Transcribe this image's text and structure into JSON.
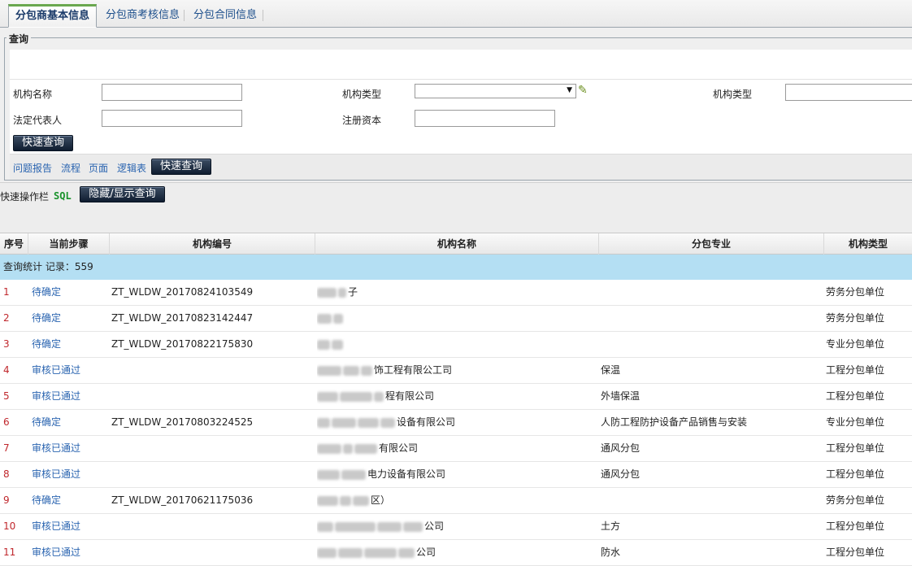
{
  "tabs": [
    {
      "label": "分包商基本信息",
      "active": true
    },
    {
      "label": "分包商考核信息",
      "active": false
    },
    {
      "label": "分包合同信息",
      "active": false
    }
  ],
  "query": {
    "legend": "查询",
    "fields": {
      "org_name_label": "机构名称",
      "org_type_label": "机构类型",
      "org_type2_label": "机构类型",
      "legal_rep_label": "法定代表人",
      "capital_label": "注册资本"
    },
    "quick_search_label": "快速查询",
    "links": [
      "问题报告",
      "流程",
      "页面",
      "逻辑表"
    ],
    "quick_search_label2": "快速查询"
  },
  "quickbar": {
    "label": "快速操作栏",
    "sql": "SQL",
    "toggle_label": "隐藏/显示查询"
  },
  "table": {
    "headers": [
      "序号",
      "当前步骤",
      "机构编号",
      "机构名称",
      "分包专业",
      "机构类型"
    ],
    "stat": "查询统计  记录：559",
    "rows": [
      {
        "idx": "1",
        "step": "待确定",
        "code": "ZT_WLDW_20170824103549",
        "name": "子",
        "spec": "",
        "type": "劳务分包单位"
      },
      {
        "idx": "2",
        "step": "待确定",
        "code": "ZT_WLDW_20170823142447",
        "name": "",
        "spec": "",
        "type": "劳务分包单位"
      },
      {
        "idx": "3",
        "step": "待确定",
        "code": "ZT_WLDW_20170822175830",
        "name": "",
        "spec": "",
        "type": "专业分包单位"
      },
      {
        "idx": "4",
        "step": "审核已通过",
        "code": "",
        "name": "饰工程有限公工司",
        "spec": "保温",
        "type": "工程分包单位"
      },
      {
        "idx": "5",
        "step": "审核已通过",
        "code": "",
        "name": "程有限公司",
        "spec": "外墙保温",
        "type": "工程分包单位"
      },
      {
        "idx": "6",
        "step": "待确定",
        "code": "ZT_WLDW_20170803224525",
        "name": "设备有限公司",
        "spec": "人防工程防护设备产品销售与安装",
        "type": "专业分包单位"
      },
      {
        "idx": "7",
        "step": "审核已通过",
        "code": "",
        "name": "有限公司",
        "spec": "通风分包",
        "type": "工程分包单位"
      },
      {
        "idx": "8",
        "step": "审核已通过",
        "code": "",
        "name": "电力设备有限公司",
        "spec": "通风分包",
        "type": "工程分包单位"
      },
      {
        "idx": "9",
        "step": "待确定",
        "code": "ZT_WLDW_20170621175036",
        "name": "区）",
        "spec": "",
        "type": "劳务分包单位"
      },
      {
        "idx": "10",
        "step": "审核已通过",
        "code": "",
        "name": "公司",
        "spec": "土方",
        "type": "工程分包单位"
      },
      {
        "idx": "11",
        "step": "审核已通过",
        "code": "",
        "name": "公司",
        "spec": "防水",
        "type": "工程分包单位"
      }
    ]
  }
}
